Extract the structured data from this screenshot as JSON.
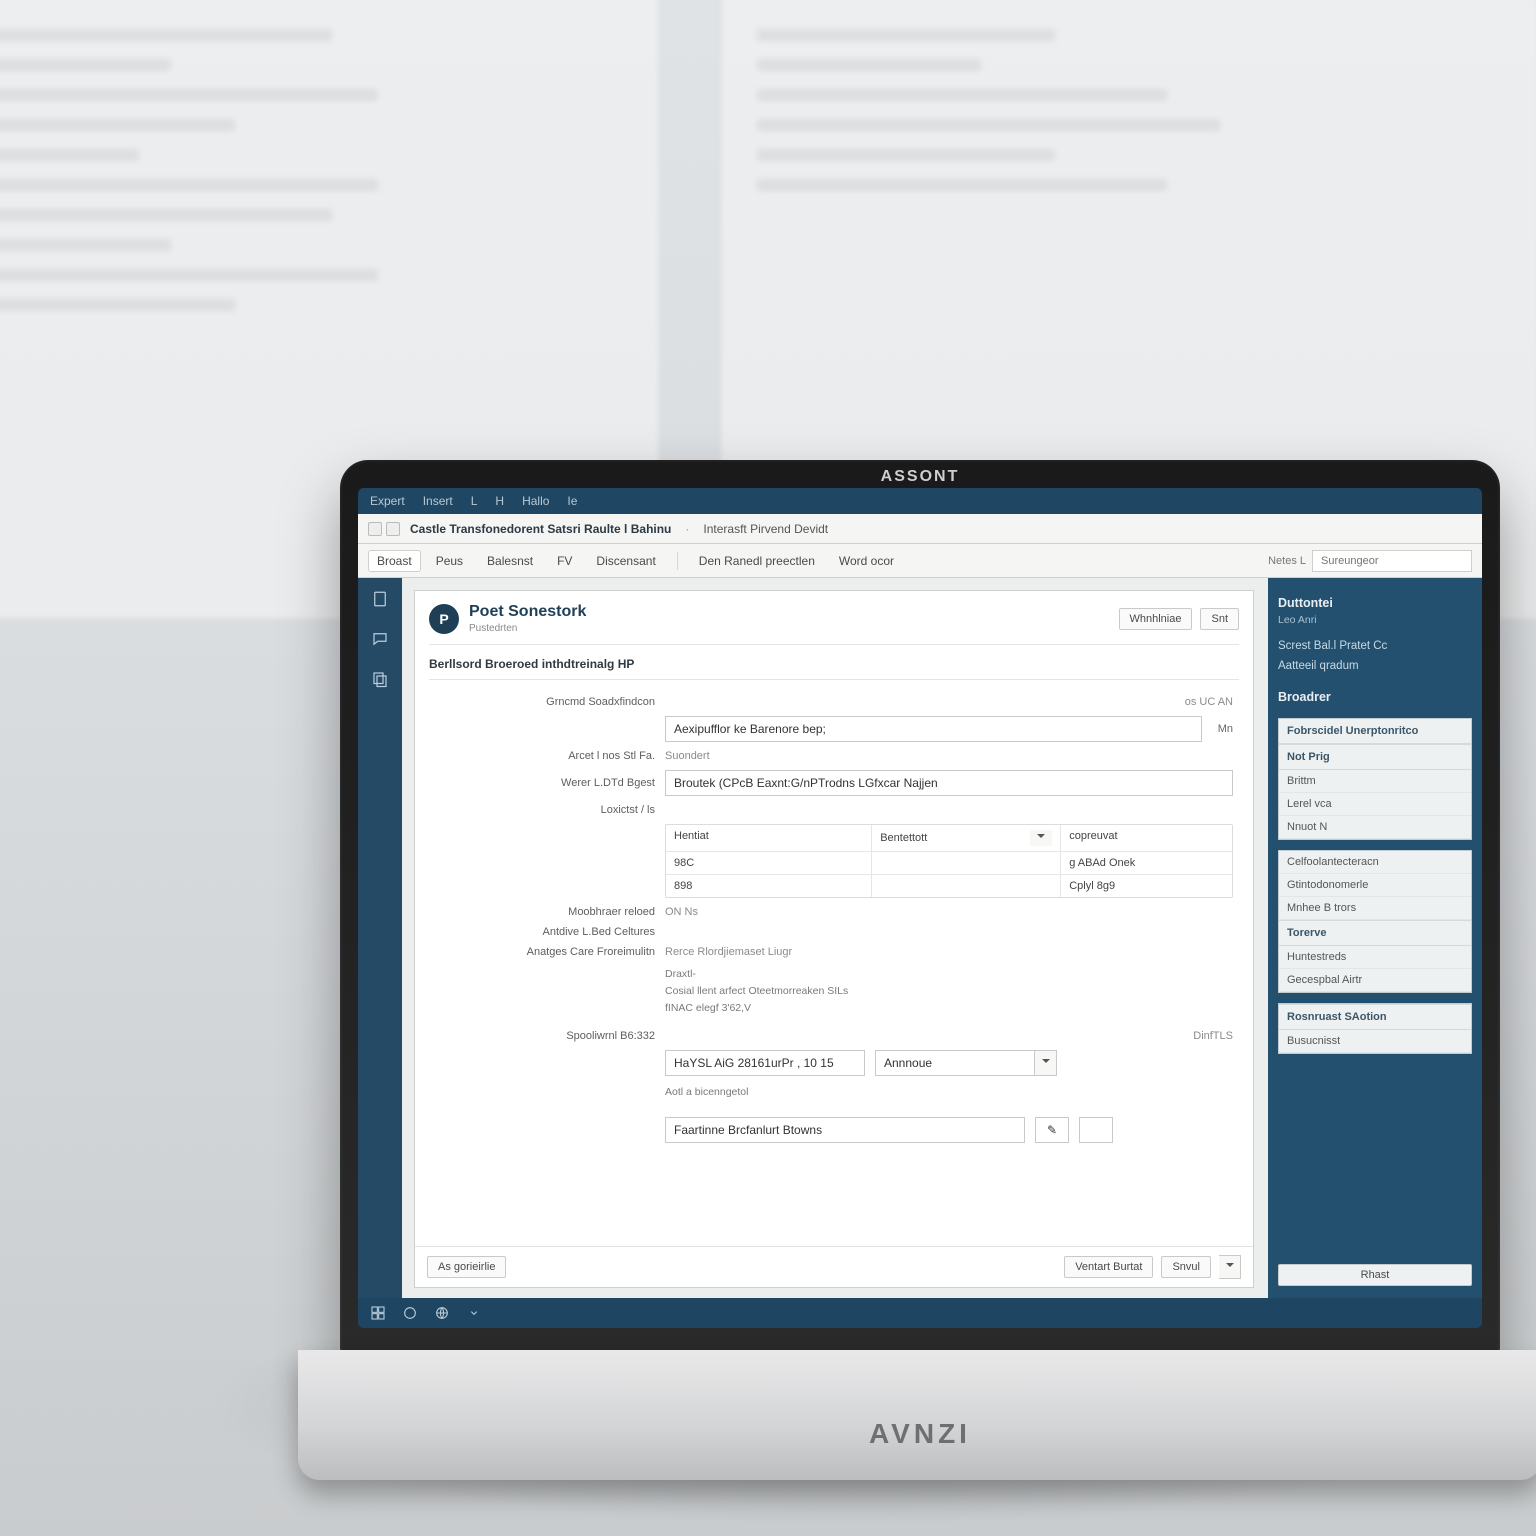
{
  "laptop": {
    "brand_top": "ASSONT",
    "brand_bottom": "AVNZI"
  },
  "menubar": {
    "items": [
      "Expert",
      "Insert",
      "L",
      "H",
      "Hallo",
      "Ie"
    ]
  },
  "window": {
    "title_primary": "Castle Transfonedorent Satsri Raulte l Bahinu",
    "title_secondary": "Interasft Pirvend Devidt"
  },
  "toolbar": {
    "items": [
      "Broast",
      "Peus",
      "Balesnst",
      "FV",
      "Discensant"
    ],
    "items2": [
      "Den Ranedl  preectlen",
      "Word ocor"
    ],
    "search_label": "Netes L",
    "search_placeholder": "Sureungeor"
  },
  "page": {
    "badge": "P",
    "title": "Poet Sonestork",
    "subtitle": "Pustedrten",
    "actions": {
      "btn1": "Whnhlniae",
      "btn2": "Snt"
    },
    "section": "Berllsord Broeroed inthdtreinalg HP",
    "fields": {
      "f1_label": "Grncmd Soadxfindcon",
      "f1_aside": "os UC  AN",
      "f2_value": "Aexipufflor ke Barenore bep;",
      "f2_unit": "Mn",
      "f3_label": "Arcet l nos  Stl Fa.",
      "f3_sublabel": "Suondert",
      "f4_label": "Werer L.DTd Bgest",
      "f4_value": "Broutek (CPcB Eaxnt:G/nPTrodns LGfxcar Najjen",
      "f5_label": "Loxictst / ls",
      "grid": {
        "r1": [
          "Hentiat",
          "Bentettott",
          "copreuvat"
        ],
        "r2": [
          "98C",
          "",
          "g ABAd Onek"
        ],
        "r3": [
          "898",
          "",
          "Cplyl 8g9"
        ]
      },
      "f6_label": "Moobhraer  reloed",
      "f6_value": "ON Ns",
      "f7_label": "Antdive L.Bed Celtures",
      "f8_label": "Anatges Care  Froreimulitn",
      "f8_value": "Rerce Rlordjiemaset Liugr",
      "note1": "Draxtl-",
      "note2": "Cosial llent arfect  Oteetmorreaken SILs",
      "note3": "fINAC elegf 3'62,V",
      "f9_label": "Spooliwrnl B6:332",
      "f9_value": "HaYSL AiG 28161urPr ,  10 15",
      "f9_dd": "Annnoue",
      "f9_aside": "DinfTLS",
      "note4": "Aotl a bicenngetol",
      "sig_value": "Faartinne Brcfanlurt Btowns",
      "sig_icon": "✎"
    },
    "footer": {
      "left": "As gorieirlie",
      "mid": "Ventart Burtat",
      "right": "Snvul"
    }
  },
  "side": {
    "heading": "Duttontei",
    "sub": "Leo Anri",
    "links": [
      "Screst Bal.l Pratet Cc",
      "Aatteeil qradum"
    ],
    "section2": "Broadrer",
    "panel1": {
      "title": "Fobrscidel Unerptonritco",
      "header": "Not Prig",
      "items": [
        "Brittm",
        "Lerel vca",
        "Nnuot  N"
      ]
    },
    "panel2": {
      "items_top": [
        "Celfoolantecteracn",
        "Gtintodonomerle"
      ],
      "label": "Mnhee  B trors",
      "header": "Torerve",
      "items": [
        "Huntestreds",
        "Gecespbal Airtr"
      ]
    },
    "panel3": {
      "header": "Rosnruast SAotion",
      "items": [
        "Busucnisst"
      ]
    },
    "footer": "Rhast"
  }
}
